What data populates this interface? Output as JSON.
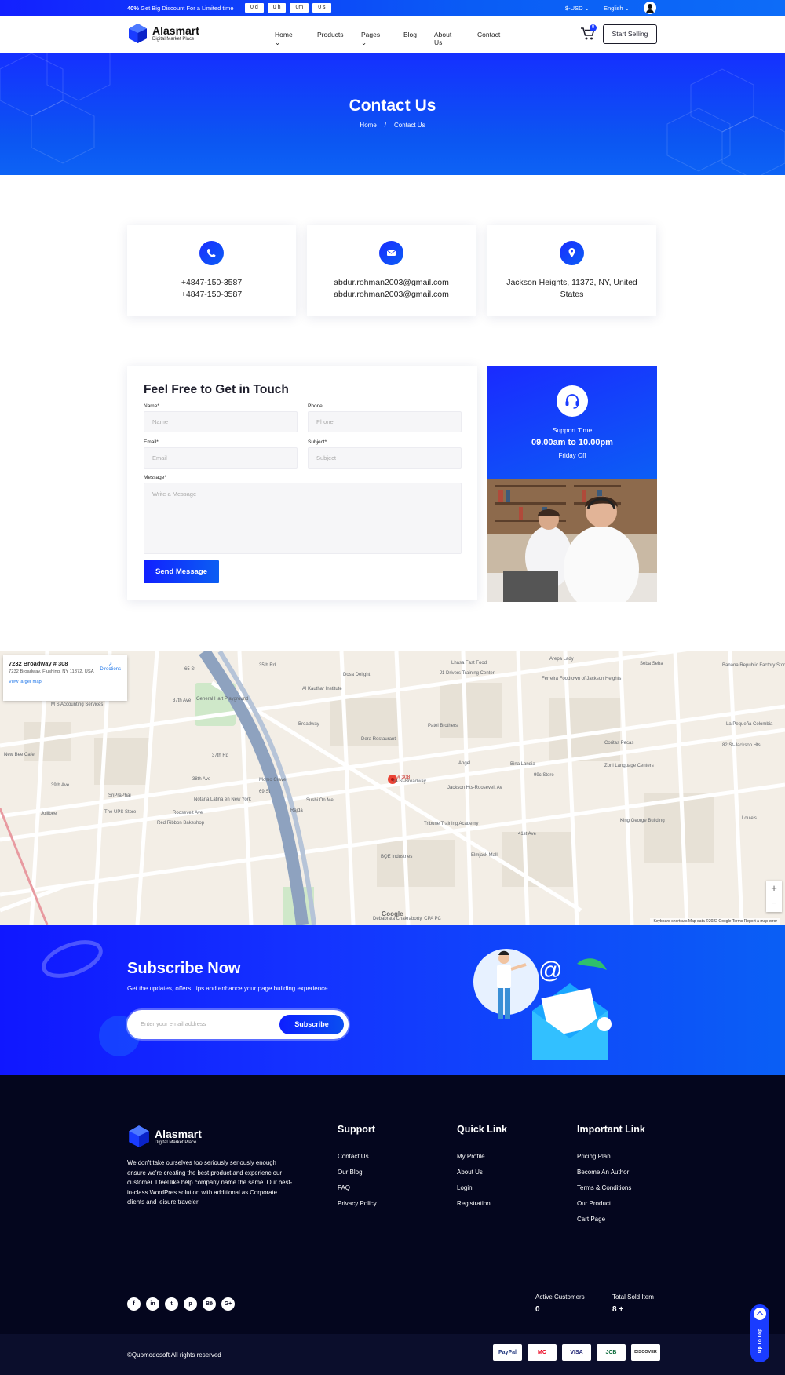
{
  "topbar": {
    "promo_bold": "40%",
    "promo_text": "Get Big Discount For a Limited time",
    "timer": [
      "0 d",
      "0 h",
      "0m",
      "0 s"
    ],
    "currency": "$-USD",
    "language": "English"
  },
  "header": {
    "brand": "Alasmart",
    "tagline": "Digital Market Place",
    "nav": [
      "Home",
      "Products",
      "Pages",
      "Blog",
      "About Us",
      "Contact"
    ],
    "cart_count": "0",
    "sell_button": "Start Selling"
  },
  "hero": {
    "title": "Contact Us",
    "breadcrumb_home": "Home",
    "breadcrumb_sep": "/",
    "breadcrumb_current": "Contact Us"
  },
  "contact_cards": [
    {
      "icon": "phone-icon",
      "line1": "+4847-150-3587",
      "line2": "+4847-150-3587"
    },
    {
      "icon": "email-icon",
      "line1": "abdur.rohman2003@gmail.com",
      "line2": "abdur.rohman2003@gmail.com"
    },
    {
      "icon": "location-icon",
      "line1": "Jackson Heights, 11372, NY, United States",
      "line2": ""
    }
  ],
  "form": {
    "title": "Feel Free to Get in Touch",
    "name_label": "Name*",
    "name_placeholder": "Name",
    "phone_label": "Phone",
    "phone_placeholder": "Phone",
    "email_label": "Email*",
    "email_placeholder": "Email",
    "subject_label": "Subject*",
    "subject_placeholder": "Subject",
    "message_label": "Message*",
    "message_placeholder": "Write a Message",
    "submit": "Send Message"
  },
  "support": {
    "label": "Support Time",
    "hours": "09.00am to 10.00pm",
    "note": "Friday Off"
  },
  "map": {
    "address_title": "7232 Broadway # 308",
    "address_full": "7232 Broadway, Flushing, NY 11372, USA",
    "larger_map": "View larger map",
    "directions": "Directions",
    "pin_label": "# 308",
    "footer_text": "Keyboard shortcuts   Map data ©2022 Google   Terms   Report a map error",
    "google": "Google",
    "zoom_in": "+",
    "zoom_out": "−",
    "labels": [
      "35th Rd",
      "37th Ave",
      "Broadway",
      "37th Rd",
      "38th Ave",
      "39th Ave",
      "Roosevelt Ave",
      "41st Ave",
      "74 St-Broadway",
      "Jackson Hts-Roosevelt Av",
      "Patel Brothers",
      "Dera Restaurant",
      "Angel",
      "Tribune Training Academy",
      "BQE Industries",
      "Elmjack Mall",
      "King George Building",
      "Zoni Language Centers",
      "82 St-Jackson Hts",
      "Dosa Delight",
      "Al Kauthar Institute",
      "M S Accounting Services",
      "General Hart Playground",
      "Momo Crave",
      "Red Ribbon Bakeshop",
      "The UPS Store",
      "Jollibee",
      "Notaria Latina en New York",
      "Ferreira Foodtown of Jackson Heights",
      "Lhasa Fast Food",
      "J1 Drivers Training Center",
      "Arepa Lady",
      "Seba Seba",
      "Banana Republic Factory Store",
      "La Pequeña Colombia",
      "Coritas Pecas",
      "Bina Landia",
      "99c Store",
      "Louie's",
      "Rajda",
      "Sushi On Me",
      "SriPraPhai",
      "New Bee Cafe",
      "Debabrata Chakraborty, CPA PC",
      "69 St",
      "65 St"
    ]
  },
  "subscribe": {
    "title": "Subscribe Now",
    "text": "Get the updates, offers, tips and enhance your page building experience",
    "placeholder": "Enter your email address",
    "button": "Subscribe"
  },
  "footer": {
    "brand": "Alasmart",
    "tagline": "Digital Market Place",
    "about": "We don't take ourselves too seriously seriously enough ensure we're creating the best product and experienc our customer. I feel like help company name the same. Our best-in-class WordPres solution with additional as Corporate clients and leisure traveler",
    "columns": [
      {
        "title": "Support",
        "links": [
          "Contact Us",
          "Our Blog",
          "FAQ",
          "Privacy Policy"
        ]
      },
      {
        "title": "Quick Link",
        "links": [
          "My Profile",
          "About Us",
          "Login",
          "Registration"
        ]
      },
      {
        "title": "Important Link",
        "links": [
          "Pricing Plan",
          "Become An Author",
          "Terms & Conditions",
          "Our Product",
          "Cart Page"
        ]
      }
    ],
    "social": [
      "f",
      "in",
      "t",
      "p",
      "Bē",
      "G+"
    ],
    "stats": [
      {
        "label": "Active Customers",
        "value": "0"
      },
      {
        "label": "Total Sold Item",
        "value": "8 +"
      }
    ],
    "copyright": "©Quomodosoft All rights reserved",
    "payments": [
      "PayPal",
      "MC",
      "VISA",
      "JCB",
      "DISCOVER"
    ],
    "up_to_top": "Up To Top"
  },
  "colors": {
    "accent": "#1a3cff",
    "footer_bg": "#04061e"
  }
}
